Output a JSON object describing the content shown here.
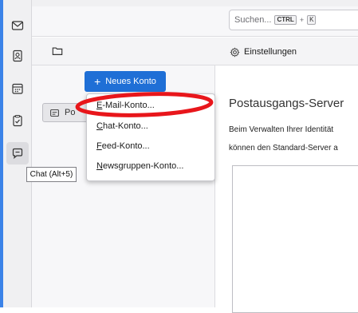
{
  "search": {
    "placeholder": "Suchen...",
    "shortcut_mod": "CTRL",
    "shortcut_plus": "+",
    "shortcut_key": "K"
  },
  "tabs": {
    "settings_label": "Einstellungen"
  },
  "folder_pane": {
    "new_account_label": "Neues Konto",
    "new_account_icon": "+",
    "account_label": "Po"
  },
  "menu": {
    "items": [
      {
        "pre": "",
        "acc": "E",
        "post": "-Mail-Konto..."
      },
      {
        "pre": "",
        "acc": "C",
        "post": "hat-Konto..."
      },
      {
        "pre": "",
        "acc": "F",
        "post": "eed-Konto..."
      },
      {
        "pre": "",
        "acc": "N",
        "post": "ewsgruppen-Konto..."
      }
    ]
  },
  "content": {
    "title": "Postausgangs-Server",
    "desc1": "Beim Verwalten Ihrer Identität",
    "desc2": "können den Standard-Server a"
  },
  "tooltip": {
    "text": "Chat (Alt+5)"
  },
  "colors": {
    "accent": "#1f6fd6",
    "annotation": "#e8161b"
  }
}
